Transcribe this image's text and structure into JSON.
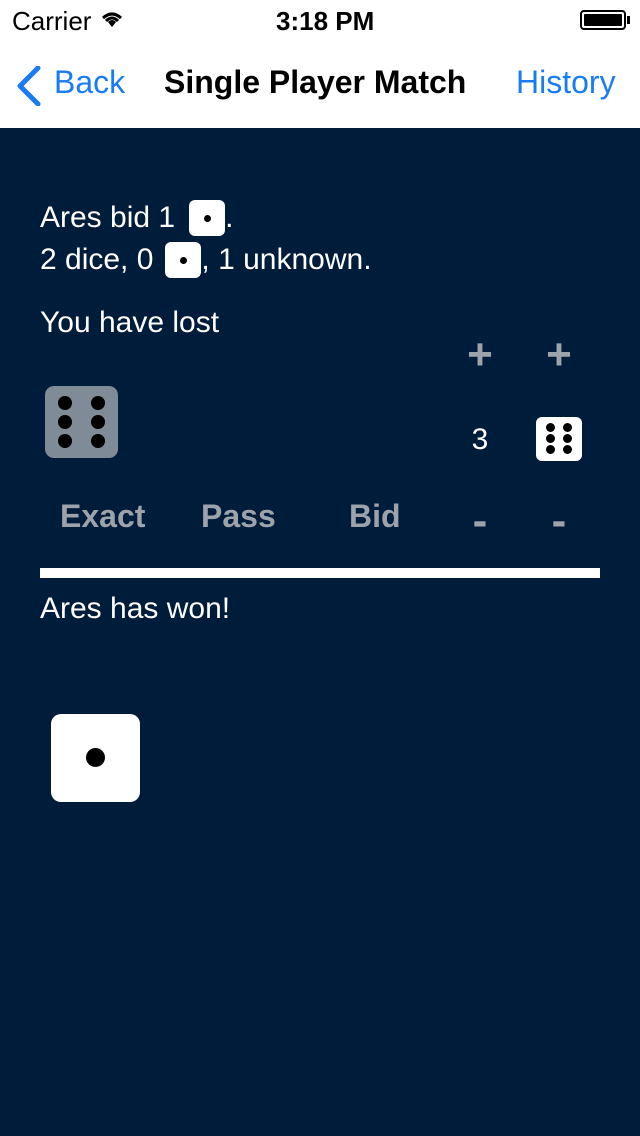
{
  "status": {
    "carrier": "Carrier",
    "time": "3:18 PM",
    "icons": [
      "wifi-icon",
      "battery-icon"
    ]
  },
  "nav": {
    "back_label": "Back",
    "title": "Single Player Match",
    "history_label": "History"
  },
  "game": {
    "line1_prefix": "Ares bid 1",
    "line1_suffix": ".",
    "line2_prefix": "2 dice, 0",
    "line2_suffix": ", 1 unknown.",
    "lost_text": "You have lost",
    "bid_count": "3",
    "plus_symbol": "+",
    "minus_symbol": "-",
    "exact_label": "Exact",
    "pass_label": "Pass",
    "bid_label": "Bid",
    "won_text": "Ares has won!",
    "your_die_face": 6,
    "bid_face": 6,
    "ares_die_face": 1
  },
  "colors": {
    "background": "#001c3b",
    "accent": "#1a7cf5",
    "disabled": "#9ca3ab"
  }
}
